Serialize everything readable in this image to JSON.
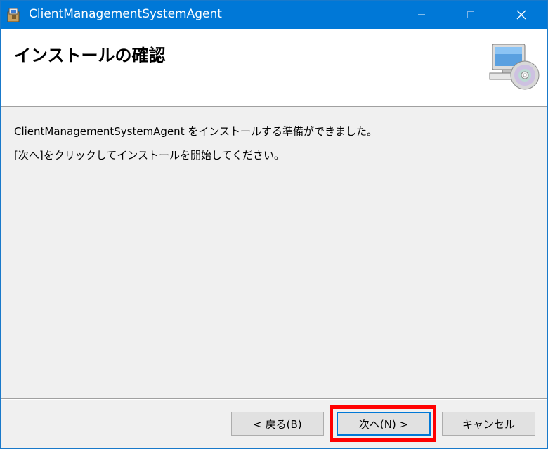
{
  "window": {
    "title": "ClientManagementSystemAgent"
  },
  "header": {
    "title": "インストールの確認"
  },
  "content": {
    "message_ready": "ClientManagementSystemAgent をインストールする準備ができました。",
    "message_instruction": "[次へ]をクリックしてインストールを開始してください。"
  },
  "buttons": {
    "back": "< 戻る(B)",
    "next": "次へ(N) >",
    "cancel": "キャンセル"
  },
  "icons": {
    "app": "installer-app-icon",
    "header": "computer-cd-icon",
    "minimize": "minimize-icon",
    "maximize": "maximize-icon",
    "close": "close-icon"
  },
  "colors": {
    "titlebar": "#0078d7",
    "highlight": "#ff0000",
    "default_button_border": "#0078d7"
  }
}
